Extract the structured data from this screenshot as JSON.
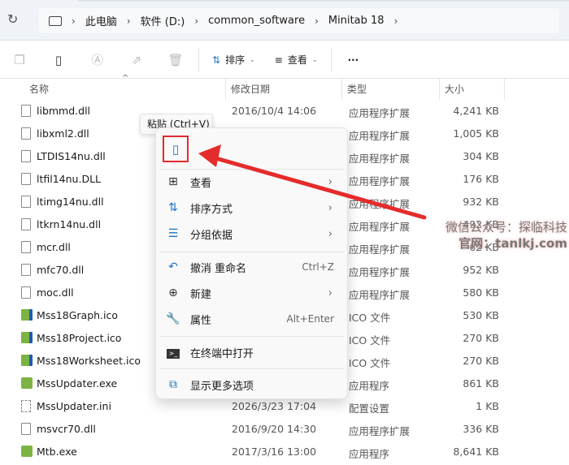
{
  "address": {
    "segments": [
      "此电脑",
      "软件 (D:)",
      "common_software",
      "Minitab 18"
    ]
  },
  "toolbar": {
    "sort": "排序",
    "view": "查看",
    "more": "···"
  },
  "columns": {
    "name": "名称",
    "date": "修改日期",
    "type": "类型",
    "size": "大小"
  },
  "files": [
    {
      "name": "libmmd.dll",
      "date": "2016/10/4 14:06",
      "type": "应用程序扩展",
      "size": "4,241 KB",
      "icon": "dll"
    },
    {
      "name": "libxml2.dll",
      "date": "",
      "type": "应用程序扩展",
      "size": "1,005 KB",
      "icon": "dll"
    },
    {
      "name": "LTDIS14nu.dll",
      "date": "",
      "type": "应用程序扩展",
      "size": "304 KB",
      "icon": "dll"
    },
    {
      "name": "ltfil14nu.DLL",
      "date": "",
      "type": "应用程序扩展",
      "size": "176 KB",
      "icon": "dll"
    },
    {
      "name": "ltimg14nu.dll",
      "date": "",
      "type": "应用程序扩展",
      "size": "932 KB",
      "icon": "dll"
    },
    {
      "name": "ltkrn14nu.dll",
      "date": "",
      "type": "应用程序扩展",
      "size": "492 KB",
      "icon": "dll"
    },
    {
      "name": "mcr.dll",
      "date": "",
      "type": "应用程序扩展",
      "size": "62 KB",
      "icon": "dll"
    },
    {
      "name": "mfc70.dll",
      "date": "",
      "type": "应用程序扩展",
      "size": "952 KB",
      "icon": "dll"
    },
    {
      "name": "moc.dll",
      "date": "",
      "type": "应用程序扩展",
      "size": "580 KB",
      "icon": "dll"
    },
    {
      "name": "Mss18Graph.ico",
      "date": "",
      "type": "ICO 文件",
      "size": "530 KB",
      "icon": "ico"
    },
    {
      "name": "Mss18Project.ico",
      "date": "",
      "type": "ICO 文件",
      "size": "270 KB",
      "icon": "ico"
    },
    {
      "name": "Mss18Worksheet.ico",
      "date": "",
      "type": "ICO 文件",
      "size": "270 KB",
      "icon": "ico"
    },
    {
      "name": "MssUpdater.exe",
      "date": "",
      "type": "应用程序",
      "size": "861 KB",
      "icon": "app"
    },
    {
      "name": "MssUpdater.ini",
      "date": "2026/3/23 17:04",
      "type": "配置设置",
      "size": "1 KB",
      "icon": "ini"
    },
    {
      "name": "msvcr70.dll",
      "date": "2016/9/20 14:30",
      "type": "应用程序扩展",
      "size": "336 KB",
      "icon": "dll"
    },
    {
      "name": "Mtb.exe",
      "date": "2017/3/16 13:00",
      "type": "应用程序",
      "size": "8,641 KB",
      "icon": "app"
    }
  ],
  "tooltip": "粘贴 (Ctrl+V)",
  "menu": {
    "view": "查看",
    "sort": "排序方式",
    "group": "分组依据",
    "undo": "撤消 重命名",
    "undo_shortcut": "Ctrl+Z",
    "new": "新建",
    "properties": "属性",
    "properties_shortcut": "Alt+Enter",
    "terminal": "在终端中打开",
    "more": "显示更多选项"
  },
  "watermark": {
    "line1": "微信公众号：探临科技",
    "line2": "官网：tanlkj.com"
  },
  "colors": {
    "accent": "#1a73c8",
    "annotation": "#e52b2b"
  }
}
